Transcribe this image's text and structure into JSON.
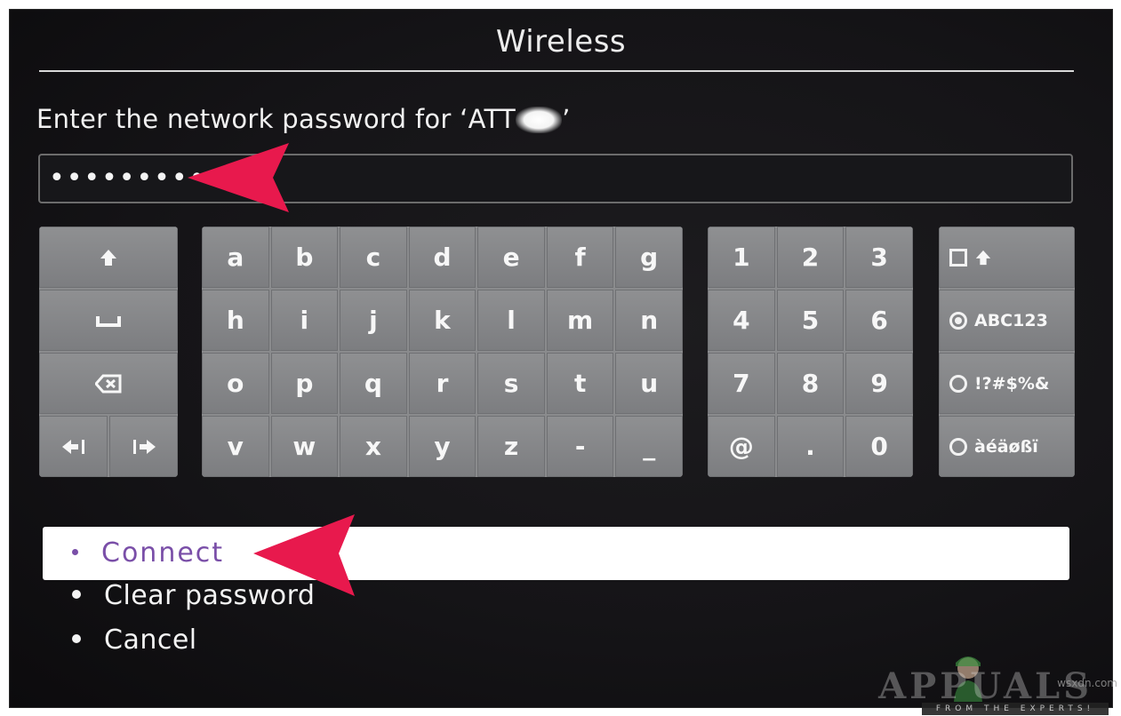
{
  "header": {
    "title": "Wireless"
  },
  "password_prompt": {
    "label_prefix": "Enter the network password for ‘ATT",
    "label_suffix": "’",
    "value": "••••••••••"
  },
  "keyboard": {
    "letters": [
      "a",
      "b",
      "c",
      "d",
      "e",
      "f",
      "g",
      "h",
      "i",
      "j",
      "k",
      "l",
      "m",
      "n",
      "o",
      "p",
      "q",
      "r",
      "s",
      "t",
      "u",
      "v",
      "w",
      "x",
      "y",
      "z",
      "-",
      "_"
    ],
    "numbers": [
      "1",
      "2",
      "3",
      "4",
      "5",
      "6",
      "7",
      "8",
      "9",
      "@",
      ".",
      "0"
    ],
    "modes": [
      {
        "label": "",
        "icon": "checkbox-shift-icon"
      },
      {
        "label": "ABC123",
        "icon": "radio-selected-icon",
        "selected": true
      },
      {
        "label": "!?#$%&",
        "icon": "radio-icon",
        "selected": false
      },
      {
        "label": "àéäøßï",
        "icon": "radio-icon",
        "selected": false
      }
    ],
    "control_icons": [
      "shift-icon",
      "space-icon",
      "backspace-icon",
      "cursor-left-icon",
      "cursor-right-icon"
    ]
  },
  "menu": {
    "items": [
      {
        "label": "Connect",
        "selected": true
      },
      {
        "label": "Clear password",
        "selected": false
      },
      {
        "label": "Cancel",
        "selected": false
      }
    ],
    "highlight_color": "#7a4fa8"
  },
  "annotations": {
    "arrow_color": "#e8194d"
  },
  "watermark": {
    "brand": "APPUALS",
    "tagline": "FROM THE EXPERTS!",
    "site": "wsxdn.com"
  }
}
